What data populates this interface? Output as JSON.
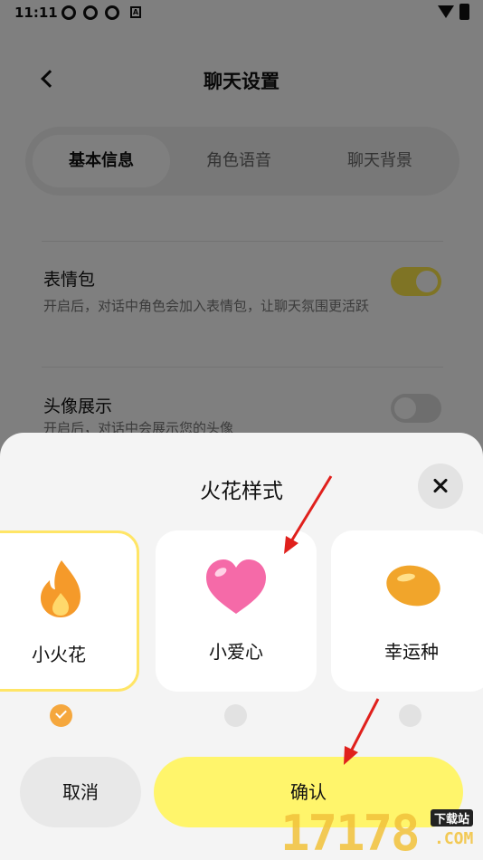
{
  "status_bar": {
    "time": "11:11",
    "a_badge": "A"
  },
  "header": {
    "title": "聊天设置"
  },
  "tabs": [
    {
      "label": "基本信息",
      "active": true
    },
    {
      "label": "角色语音",
      "active": false
    },
    {
      "label": "聊天背景",
      "active": false
    }
  ],
  "settings": [
    {
      "title": "表情包",
      "desc": "开启后，对话中角色会加入表情包，让聊天氛围更活跃",
      "enabled": true
    },
    {
      "title": "头像展示",
      "desc": "开启后，对话中会展示您的头像",
      "enabled": false
    }
  ],
  "sheet": {
    "title": "火花样式",
    "options": [
      {
        "label": "小火花",
        "icon": "flame-icon",
        "selected": true
      },
      {
        "label": "小爱心",
        "icon": "heart-icon",
        "selected": false
      },
      {
        "label": "幸运种",
        "icon": "seed-icon",
        "selected": false
      }
    ],
    "cancel_label": "取消",
    "confirm_label": "确认"
  },
  "watermark": {
    "number": "17178",
    "tag": "下载站",
    "domain": ".COM"
  },
  "colors": {
    "accent_yellow": "#fff56b",
    "selected_border": "#ffe566",
    "check_orange": "#f5a73d",
    "arrow_red": "#e0201c"
  }
}
